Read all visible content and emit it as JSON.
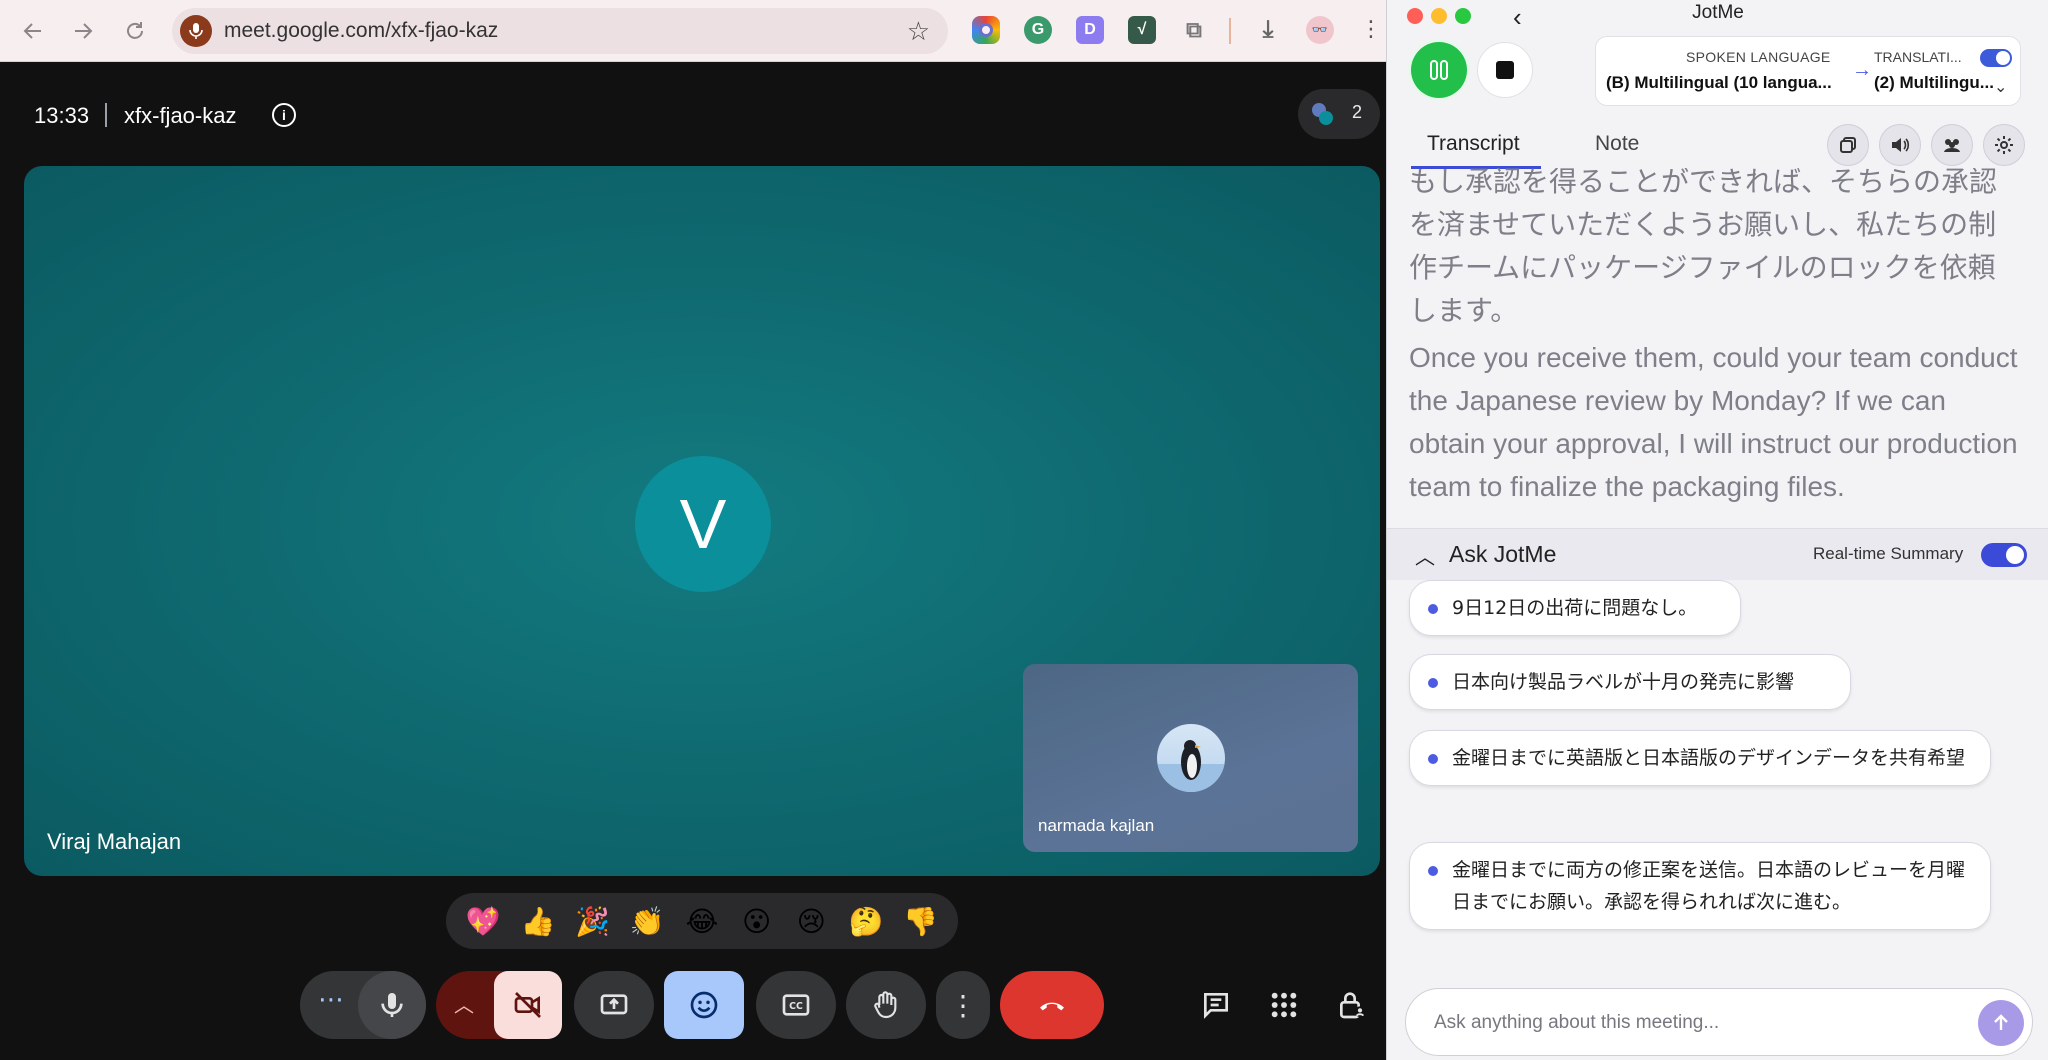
{
  "browser": {
    "url": "meet.google.com/xfx-fjao-kaz",
    "nav_icons": [
      "back-arrow-icon",
      "forward-arrow-icon",
      "reload-icon"
    ],
    "extensions": [
      "chrome-extension-icon",
      "grammarly-icon",
      "extension-d-icon",
      "extension-v-icon",
      "puzzle-extensions-icon",
      "download-icon",
      "profile-avatar-icon"
    ]
  },
  "meet": {
    "time": "13:33",
    "meeting_code": "xfx-fjao-kaz",
    "participant_count": "2",
    "main_participant": {
      "initial": "V",
      "name": "Viraj Mahajan"
    },
    "self_view": {
      "name": "narmada kajlan"
    },
    "reactions": [
      "💖",
      "👍",
      "🎉",
      "👏",
      "😂",
      "😮",
      "😢",
      "🤔",
      "👎"
    ],
    "colors": {
      "tile": "#0f6b71",
      "avatar": "#0b8f9a",
      "end_call": "#dc362e",
      "emoji_active": "#a8c7fa",
      "camera_off": "#f9dedc"
    }
  },
  "jotme": {
    "title": "JotMe",
    "spoken_language_label": "SPOKEN LANGUAGE",
    "spoken_language_value": "(B) Multilingual (10 langua...",
    "translation_label": "TRANSLATI...",
    "translation_value": "(2) Multilingu...",
    "tabs": {
      "transcript": "Transcript",
      "note": "Note"
    },
    "transcript_ja": "もし承認を得ることができれば、そちらの承認を済ませていただくようお願いし、私たちの制作チームにパッケージファイルのロックを依頼します。",
    "transcript_en": "Once you receive them, could your team conduct the Japanese review by Monday? If we can obtain your approval, I will instruct our production team to finalize the packaging files.",
    "ask_title": "Ask JotMe",
    "realtime_summary_label": "Real-time Summary",
    "summary_items": [
      "9日12日の出荷に問題なし。",
      "日本向け製品ラベルが十月の発売に影響",
      "金曜日までに英語版と日本語版のデザインデータを共有希望",
      "金曜日までに両方の修正案を送信。日本語のレビューを月曜日までにお願い。承認を得られれば次に進む。"
    ],
    "ask_placeholder": "Ask anything about this meeting...",
    "colors": {
      "accent": "#3b4bd8",
      "record_green": "#22c04a",
      "send_button": "#a99ae8"
    }
  }
}
